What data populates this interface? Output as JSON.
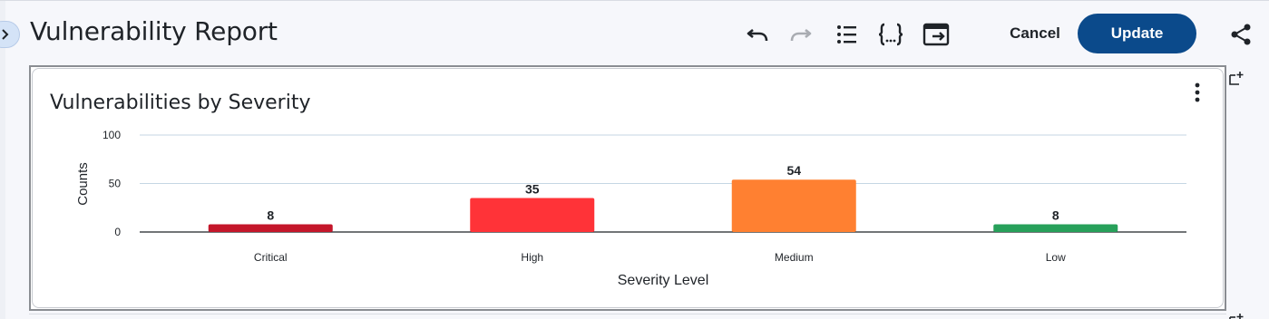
{
  "header": {
    "title": "Vulnerability Report",
    "cancel_label": "Cancel",
    "update_label": "Update"
  },
  "icons": {
    "expand": "chevron-right-icon",
    "undo": "undo-icon",
    "redo": "redo-icon",
    "list": "list-icon",
    "json": "code-braces-icon",
    "export": "export-icon",
    "share": "share-icon",
    "more": "more-vertical-icon",
    "add_panel": "add-panel-icon"
  },
  "colors": {
    "primary": "#0b4a8b",
    "critical": "#c4162a",
    "high": "#ff3338",
    "medium": "#ff8031",
    "low": "#27a05a"
  },
  "panel": {
    "title": "Vulnerabilities by Severity"
  },
  "chart_data": {
    "type": "bar",
    "title": "Vulnerabilities by Severity",
    "xlabel": "Severity Level",
    "ylabel": "Counts",
    "categories": [
      "Critical",
      "High",
      "Medium",
      "Low"
    ],
    "values": [
      8,
      35,
      54,
      8
    ],
    "bar_colors": [
      "#c4162a",
      "#ff3338",
      "#ff8031",
      "#27a05a"
    ],
    "yticks": [
      0,
      50,
      100
    ],
    "ylim": [
      0,
      100
    ],
    "grid": true,
    "data_labels": true
  }
}
